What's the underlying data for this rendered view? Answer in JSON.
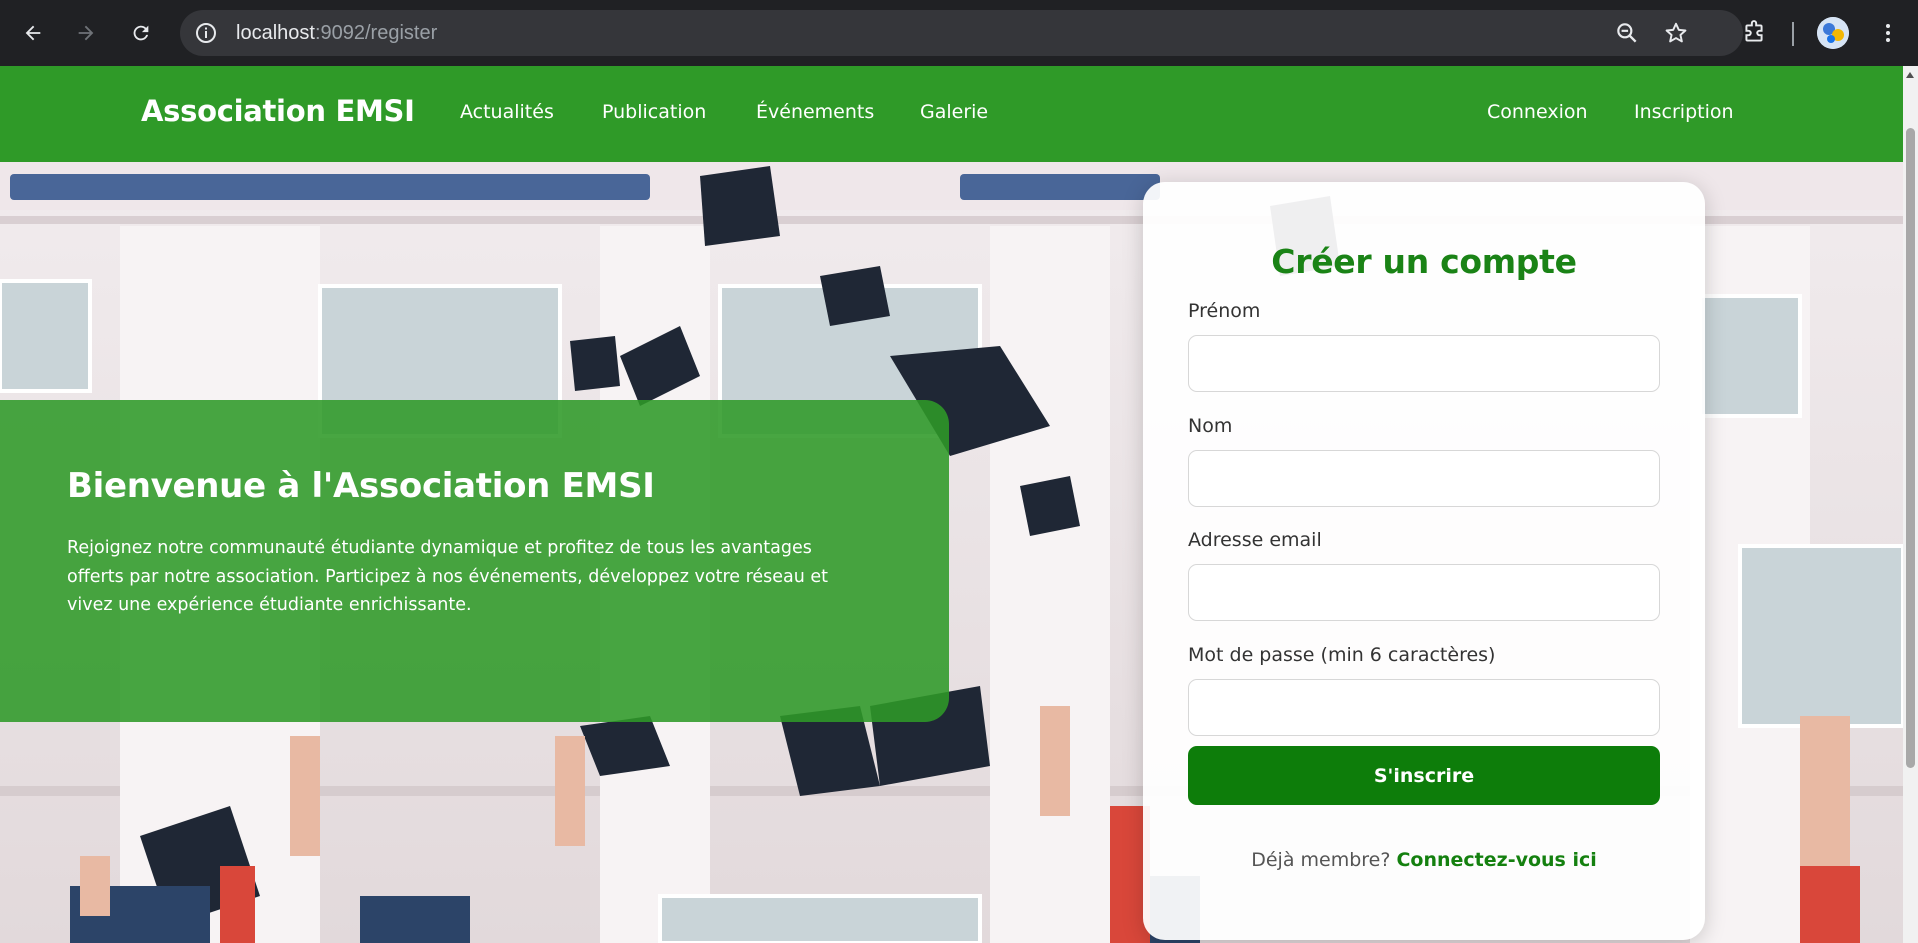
{
  "browser": {
    "url_host": "localhost",
    "url_rest": ":9092/register"
  },
  "navbar": {
    "brand": "Association EMSI",
    "links": [
      "Actualités",
      "Publication",
      "Événements",
      "Galerie"
    ],
    "auth_links": [
      "Connexion",
      "Inscription"
    ],
    "color": "#2f9a28"
  },
  "welcome": {
    "title": "Bienvenue à l'Association EMSI",
    "text": "Rejoignez notre communauté étudiante dynamique et profitez de tous les avantages offerts par notre association. Participez à nos événements, développez votre réseau et vivez une expérience étudiante enrichissante."
  },
  "form": {
    "title": "Créer un compte",
    "fields": [
      {
        "label": "Prénom",
        "value": ""
      },
      {
        "label": "Nom",
        "value": ""
      },
      {
        "label": "Adresse email",
        "value": ""
      },
      {
        "label": "Mot de passe (min 6 caractères)",
        "value": ""
      }
    ],
    "submit_label": "S'inscrire",
    "login_prompt": "Déjà membre?",
    "login_link": "Connectez-vous ici",
    "accent": "#0d7d0a"
  }
}
